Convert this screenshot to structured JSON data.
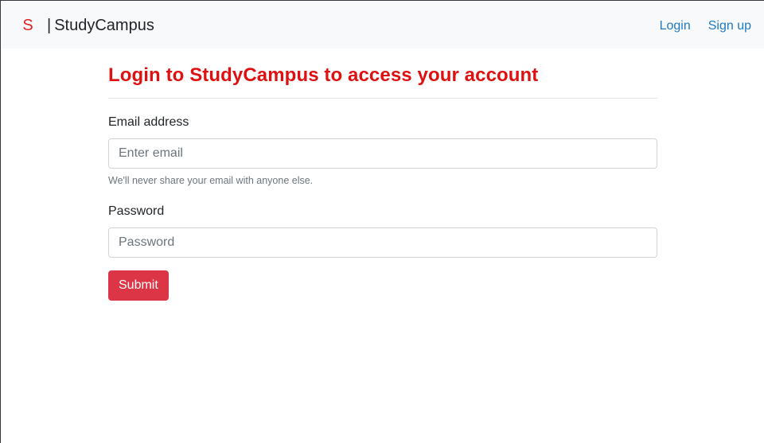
{
  "navbar": {
    "logo_text": "S",
    "separator": "|",
    "brand_name": "StudyCampus",
    "links": [
      {
        "label": "Login"
      },
      {
        "label": "Sign up"
      }
    ]
  },
  "main": {
    "title": "Login to StudyCampus to access your account",
    "email": {
      "label": "Email address",
      "placeholder": "Enter email",
      "value": "",
      "help": "We'll never share your email with anyone else."
    },
    "password": {
      "label": "Password",
      "placeholder": "Password",
      "value": ""
    },
    "submit_label": "Submit"
  },
  "colors": {
    "accent": "#dc3545",
    "title": "#dd1111",
    "link": "#1f7ac4",
    "navbar_bg": "#f8f9fa"
  }
}
